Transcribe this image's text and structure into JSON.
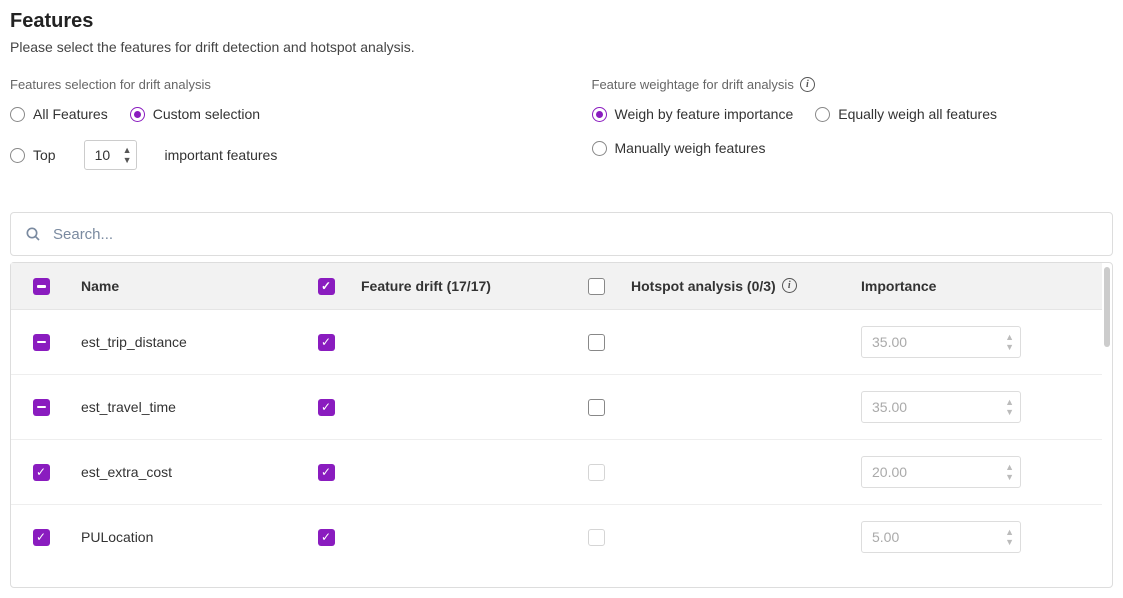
{
  "title": "Features",
  "subtitle": "Please select the features for drift detection and hotspot analysis.",
  "selection_section": {
    "label": "Features selection for drift analysis",
    "all_label": "All Features",
    "custom_label": "Custom selection",
    "top_label": "Top",
    "top_value": "10",
    "important_label": "important features",
    "selected": "custom"
  },
  "weight_section": {
    "label": "Feature weightage for drift analysis",
    "by_importance": "Weigh by feature importance",
    "equally": "Equally weigh all features",
    "manually": "Manually weigh features",
    "selected": "by_importance"
  },
  "search": {
    "placeholder": "Search..."
  },
  "table": {
    "headers": {
      "name": "Name",
      "drift": "Feature drift (17/17)",
      "hotspot": "Hotspot analysis (0/3)",
      "importance": "Importance"
    },
    "select_all_state": "indeterminate",
    "drift_all_checked": true,
    "hotspot_all_checked": false,
    "rows": [
      {
        "name": "est_trip_distance",
        "row_state": "indeterminate",
        "drift": true,
        "hotspot": false,
        "hotspot_disabled": false,
        "importance": "35.00"
      },
      {
        "name": "est_travel_time",
        "row_state": "indeterminate",
        "drift": true,
        "hotspot": false,
        "hotspot_disabled": false,
        "importance": "35.00"
      },
      {
        "name": "est_extra_cost",
        "row_state": "checked",
        "drift": true,
        "hotspot": false,
        "hotspot_disabled": true,
        "importance": "20.00"
      },
      {
        "name": "PULocation",
        "row_state": "checked",
        "drift": true,
        "hotspot": false,
        "hotspot_disabled": true,
        "importance": "5.00"
      }
    ]
  },
  "colors": {
    "accent": "#8a1cbf"
  }
}
